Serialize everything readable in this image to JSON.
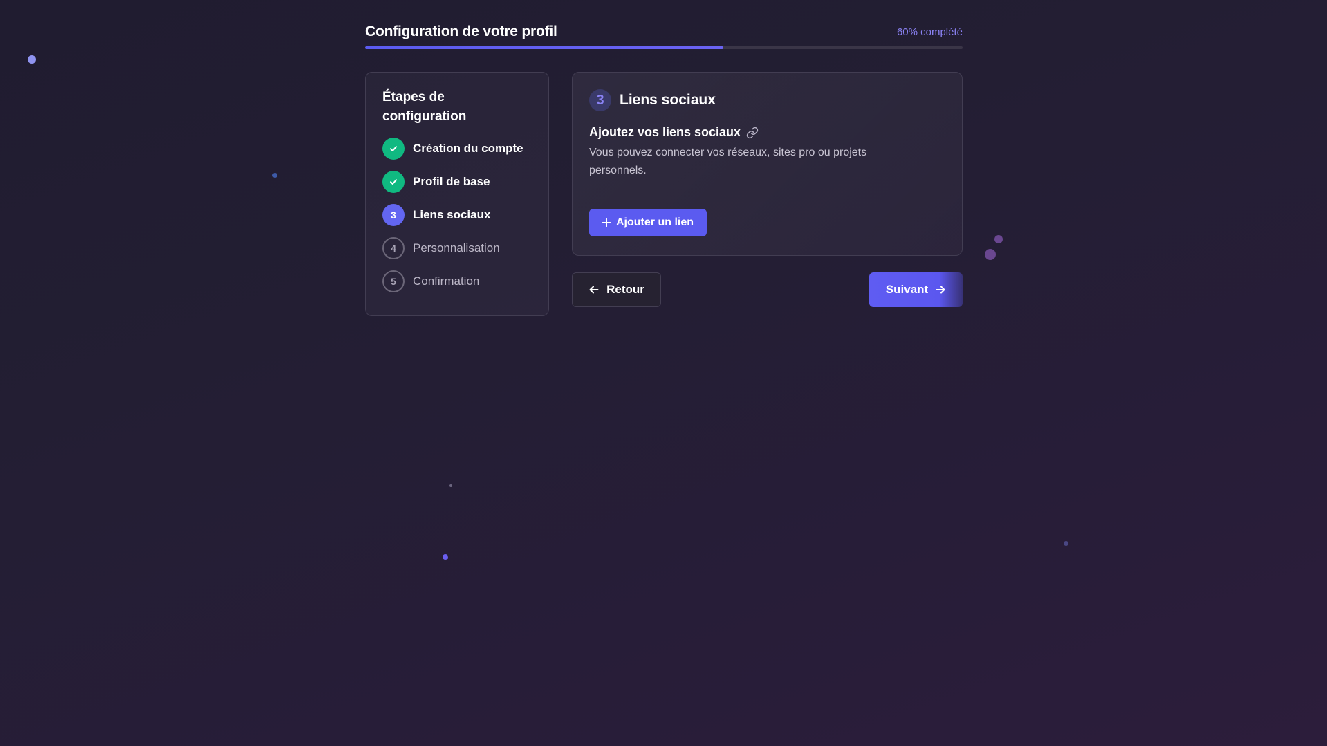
{
  "header": {
    "title": "Configuration de votre profil",
    "progress_label": "60% complété",
    "progress_fraction": 0.6
  },
  "steps": {
    "title": "Étapes de configuration",
    "items": [
      {
        "badge": "",
        "label": "Création du compte",
        "state": "done"
      },
      {
        "badge": "",
        "label": "Profil de base",
        "state": "done"
      },
      {
        "badge": "3",
        "label": "Liens sociaux",
        "state": "current"
      },
      {
        "badge": "4",
        "label": "Personnalisation",
        "state": "todo"
      },
      {
        "badge": "5",
        "label": "Confirmation",
        "state": "todo"
      }
    ]
  },
  "content": {
    "step_number": "3",
    "title": "Liens sociaux",
    "subtitle": "Ajoutez vos liens sociaux",
    "description": "Vous pouvez connecter vos réseaux, sites pro ou projets personnels.",
    "add_button_label": "Ajouter un lien"
  },
  "nav": {
    "back_label": "Retour",
    "next_label": "Suivant"
  },
  "icons": {
    "check": "check-icon",
    "link": "link-icon",
    "plus": "plus-icon",
    "back": "arrow-left-icon",
    "next": "arrow-right-icon"
  },
  "colors": {
    "accent": "#5b5bf0",
    "success": "#10b981",
    "background": "#231e33"
  }
}
